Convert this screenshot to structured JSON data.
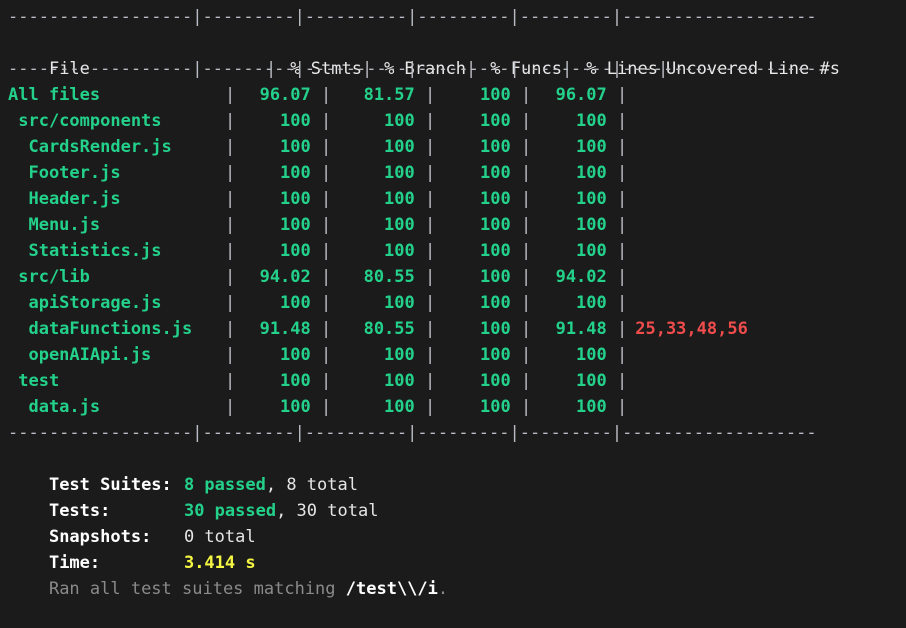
{
  "terminal": {
    "type": "jest-coverage-report",
    "separator_top": "------------------|---------|----------|---------|---------|-------------------",
    "separator_header": "------------------|---------|----------|---------|---------|-------------------",
    "separator_bottom": "------------------|---------|----------|---------|---------|-------------------"
  },
  "table": {
    "columns": [
      "File",
      "% Stmts",
      "% Branch",
      "% Funcs",
      "% Lines",
      "Uncovered Line #s"
    ],
    "rows": [
      {
        "file": "All files",
        "indent": 0,
        "stmts": "96.07",
        "branch": "81.57",
        "funcs": "100",
        "lines": "96.07",
        "uncovered": ""
      },
      {
        "file": "src/components",
        "indent": 1,
        "stmts": "100",
        "branch": "100",
        "funcs": "100",
        "lines": "100",
        "uncovered": ""
      },
      {
        "file": "CardsRender.js",
        "indent": 2,
        "stmts": "100",
        "branch": "100",
        "funcs": "100",
        "lines": "100",
        "uncovered": ""
      },
      {
        "file": "Footer.js",
        "indent": 2,
        "stmts": "100",
        "branch": "100",
        "funcs": "100",
        "lines": "100",
        "uncovered": ""
      },
      {
        "file": "Header.js",
        "indent": 2,
        "stmts": "100",
        "branch": "100",
        "funcs": "100",
        "lines": "100",
        "uncovered": ""
      },
      {
        "file": "Menu.js",
        "indent": 2,
        "stmts": "100",
        "branch": "100",
        "funcs": "100",
        "lines": "100",
        "uncovered": ""
      },
      {
        "file": "Statistics.js",
        "indent": 2,
        "stmts": "100",
        "branch": "100",
        "funcs": "100",
        "lines": "100",
        "uncovered": ""
      },
      {
        "file": "src/lib",
        "indent": 1,
        "stmts": "94.02",
        "branch": "80.55",
        "funcs": "100",
        "lines": "94.02",
        "uncovered": ""
      },
      {
        "file": "apiStorage.js",
        "indent": 2,
        "stmts": "100",
        "branch": "100",
        "funcs": "100",
        "lines": "100",
        "uncovered": ""
      },
      {
        "file": "dataFunctions.js",
        "indent": 2,
        "stmts": "91.48",
        "branch": "80.55",
        "funcs": "100",
        "lines": "91.48",
        "uncovered": "25,33,48,56"
      },
      {
        "file": "openAIApi.js",
        "indent": 2,
        "stmts": "100",
        "branch": "100",
        "funcs": "100",
        "lines": "100",
        "uncovered": ""
      },
      {
        "file": "test",
        "indent": 1,
        "stmts": "100",
        "branch": "100",
        "funcs": "100",
        "lines": "100",
        "uncovered": ""
      },
      {
        "file": "data.js",
        "indent": 2,
        "stmts": "100",
        "branch": "100",
        "funcs": "100",
        "lines": "100",
        "uncovered": ""
      }
    ]
  },
  "summary": {
    "test_suites_label": "Test Suites:",
    "test_suites_passed": "8 passed",
    "test_suites_rest": ", 8 total",
    "tests_label": "Tests:",
    "tests_passed": "30 passed",
    "tests_rest": ", 30 total",
    "snapshots_label": "Snapshots:",
    "snapshots_value": "0 total",
    "time_label": "Time:",
    "time_value": "3.414 s",
    "footer_prefix": "Ran all test suites matching ",
    "footer_pattern": "/test\\\\/i",
    "footer_suffix": "."
  },
  "colors": {
    "background": "#1b1b1b",
    "pass_green": "#23d18b",
    "fail_red": "#f14c4c",
    "time_yellow": "#f5f543",
    "text_white": "#e5e5e5",
    "dim_gray": "#8a8a8a",
    "separator": "#b9bcc4"
  }
}
